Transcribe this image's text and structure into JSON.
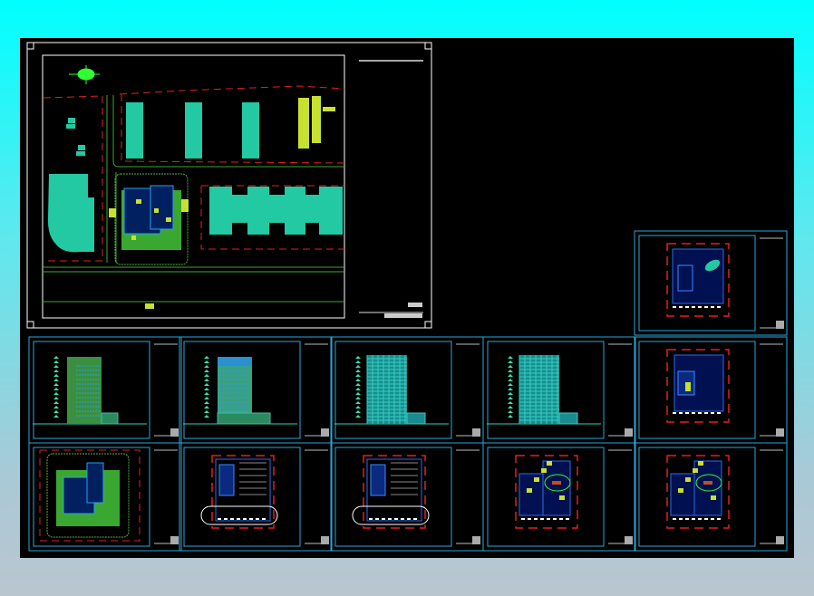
{
  "colors": {
    "background_top": "#00ffff",
    "background_bottom": "#b9c6d0",
    "model_space": "#000000",
    "sheet_frame": "#2aa8d8",
    "building_fill": "#22c9a2",
    "boundary_red": "#e02020",
    "landscape_green": "#3aa830",
    "plan_blue": "#2a6cf0",
    "annotation_yellow": "#c8e030",
    "white_frame": "#ffffff"
  },
  "site_plan": {
    "kind": "site-plan"
  },
  "sheets": [
    {
      "kind": "floor-plan",
      "row": 0,
      "col": 4,
      "variant": "roof"
    },
    {
      "kind": "elevation",
      "row": 1,
      "col": 0,
      "variant": "side-a"
    },
    {
      "kind": "elevation",
      "row": 1,
      "col": 1,
      "variant": "front-a"
    },
    {
      "kind": "elevation",
      "row": 1,
      "col": 2,
      "variant": "front-b"
    },
    {
      "kind": "elevation",
      "row": 1,
      "col": 3,
      "variant": "side-b"
    },
    {
      "kind": "floor-plan",
      "row": 1,
      "col": 4,
      "variant": "upper"
    },
    {
      "kind": "site-detail",
      "row": 2,
      "col": 0,
      "variant": "site"
    },
    {
      "kind": "floor-plan",
      "row": 2,
      "col": 1,
      "variant": "basement-a"
    },
    {
      "kind": "floor-plan",
      "row": 2,
      "col": 2,
      "variant": "basement-b"
    },
    {
      "kind": "floor-plan",
      "row": 2,
      "col": 3,
      "variant": "ground"
    },
    {
      "kind": "floor-plan",
      "row": 2,
      "col": 4,
      "variant": "ground"
    }
  ]
}
